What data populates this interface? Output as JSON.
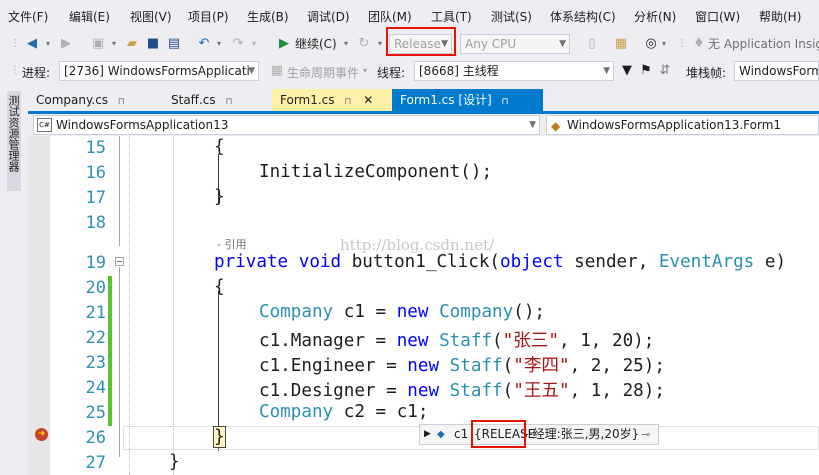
{
  "menu": [
    "文件(F)",
    "编辑(E)",
    "视图(V)",
    "项目(P)",
    "生成(B)",
    "调试(D)",
    "团队(M)",
    "工具(T)",
    "测试(S)",
    "体系结构(C)",
    "分析(N)",
    "窗口(W)",
    "帮助(H)"
  ],
  "toolbar": {
    "continue_label": "继续(C)",
    "config_value": "Release",
    "platform_value": "Any CPU",
    "insights_label": "无 Application Insig"
  },
  "debugbar": {
    "process_label": "进程:",
    "process_value": "[2736] WindowsFormsApplicati",
    "lifecycle_label": "生命周期事件",
    "thread_label": "线程:",
    "thread_value": "[8668] 主线程",
    "stackframe_label": "堆栈帧:",
    "stackframe_value": "WindowsForm"
  },
  "sidetab": {
    "label": "测试资源管理器"
  },
  "tabs": [
    {
      "label": "Company.cs"
    },
    {
      "label": "Staff.cs"
    },
    {
      "label": "Form1.cs"
    },
    {
      "label": "Form1.cs [设计]"
    }
  ],
  "nav": {
    "project": "WindowsFormsApplication13",
    "class": "WindowsFormsApplication13.Form1",
    "project_icon": "C#",
    "class_icon": "class"
  },
  "editor": {
    "lines": [
      {
        "n": "15",
        "t": "{"
      },
      {
        "n": "16",
        "t": "InitializeComponent();"
      },
      {
        "n": "17",
        "t": "}"
      },
      {
        "n": "18",
        "t": ""
      },
      {
        "n": "19",
        "t": "private void button1_Click(object sender, EventArgs e)"
      },
      {
        "n": "20",
        "t": "{"
      },
      {
        "n": "21",
        "t": "Company c1 = new Company();"
      },
      {
        "n": "22",
        "t": "c1.Manager = new Staff(\"张三\", 1, 20);"
      },
      {
        "n": "23",
        "t": "c1.Engineer = new Staff(\"李四\", 2, 25);"
      },
      {
        "n": "24",
        "t": "c1.Designer = new Staff(\"王五\", 1, 28);"
      },
      {
        "n": "25",
        "t": "Company c2 = c1;"
      },
      {
        "n": "26",
        "t": "}"
      },
      {
        "n": "27",
        "t": "}"
      }
    ],
    "codelens": "- 引用",
    "watermark": "http://blog.csdn.net/"
  },
  "datatip": {
    "var": "c1",
    "value_tag": "{RELEASE",
    "value_rest": "--经理:张三,男,20岁}"
  },
  "colors": {
    "accent": "#007acc",
    "keyword": "#0000ff",
    "type": "#2b91af",
    "string": "#a31515",
    "highlight": "#e51400",
    "changed": "#57c42b"
  }
}
